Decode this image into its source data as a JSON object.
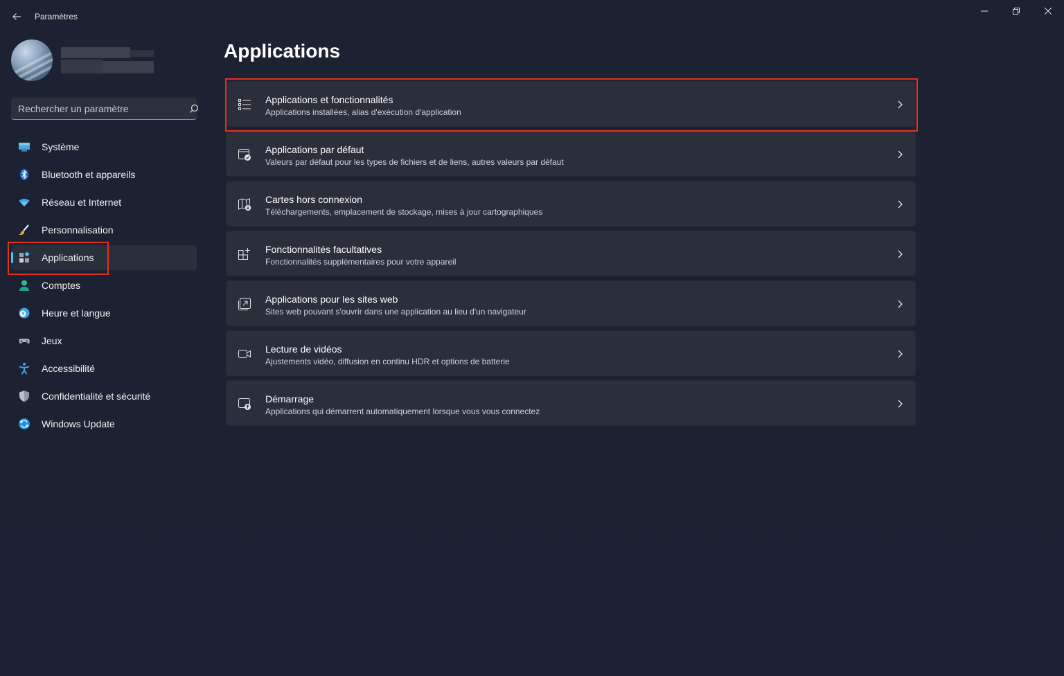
{
  "window": {
    "title": "Paramètres"
  },
  "search": {
    "placeholder": "Rechercher un paramètre"
  },
  "sidebar": {
    "items": [
      {
        "label": "Système",
        "icon": "display-icon"
      },
      {
        "label": "Bluetooth et appareils",
        "icon": "bluetooth-icon"
      },
      {
        "label": "Réseau et Internet",
        "icon": "wifi-icon"
      },
      {
        "label": "Personnalisation",
        "icon": "brush-icon"
      },
      {
        "label": "Applications",
        "icon": "apps-icon",
        "selected": true
      },
      {
        "label": "Comptes",
        "icon": "person-icon"
      },
      {
        "label": "Heure et langue",
        "icon": "clock-globe-icon"
      },
      {
        "label": "Jeux",
        "icon": "gamepad-icon"
      },
      {
        "label": "Accessibilité",
        "icon": "accessibility-icon"
      },
      {
        "label": "Confidentialité et sécurité",
        "icon": "shield-icon"
      },
      {
        "label": "Windows Update",
        "icon": "update-icon"
      }
    ]
  },
  "main": {
    "title": "Applications",
    "cards": [
      {
        "title": "Applications et fonctionnalités",
        "description": "Applications installées, alias d'exécution d'application",
        "icon": "list-icon"
      },
      {
        "title": "Applications par défaut",
        "description": "Valeurs par défaut pour les types de fichiers et de liens, autres valeurs par défaut",
        "icon": "default-app-icon"
      },
      {
        "title": "Cartes hors connexion",
        "description": "Téléchargements, emplacement de stockage, mises à jour cartographiques",
        "icon": "map-download-icon"
      },
      {
        "title": "Fonctionnalités facultatives",
        "description": "Fonctionnalités supplémentaires pour votre appareil",
        "icon": "add-grid-icon"
      },
      {
        "title": "Applications pour les sites web",
        "description": "Sites web pouvant s'ouvrir dans une application au lieu d'un navigateur",
        "icon": "open-in-app-icon"
      },
      {
        "title": "Lecture de vidéos",
        "description": "Ajustements vidéo, diffusion en continu HDR et options de batterie",
        "icon": "video-icon"
      },
      {
        "title": "Démarrage",
        "description": "Applications qui démarrent automatiquement lorsque vous vous connectez",
        "icon": "startup-icon"
      }
    ]
  },
  "colors": {
    "accent": "#4cc2ff",
    "highlight": "#e0331f",
    "background": "#1c2232",
    "card": "#2a2f3b"
  }
}
